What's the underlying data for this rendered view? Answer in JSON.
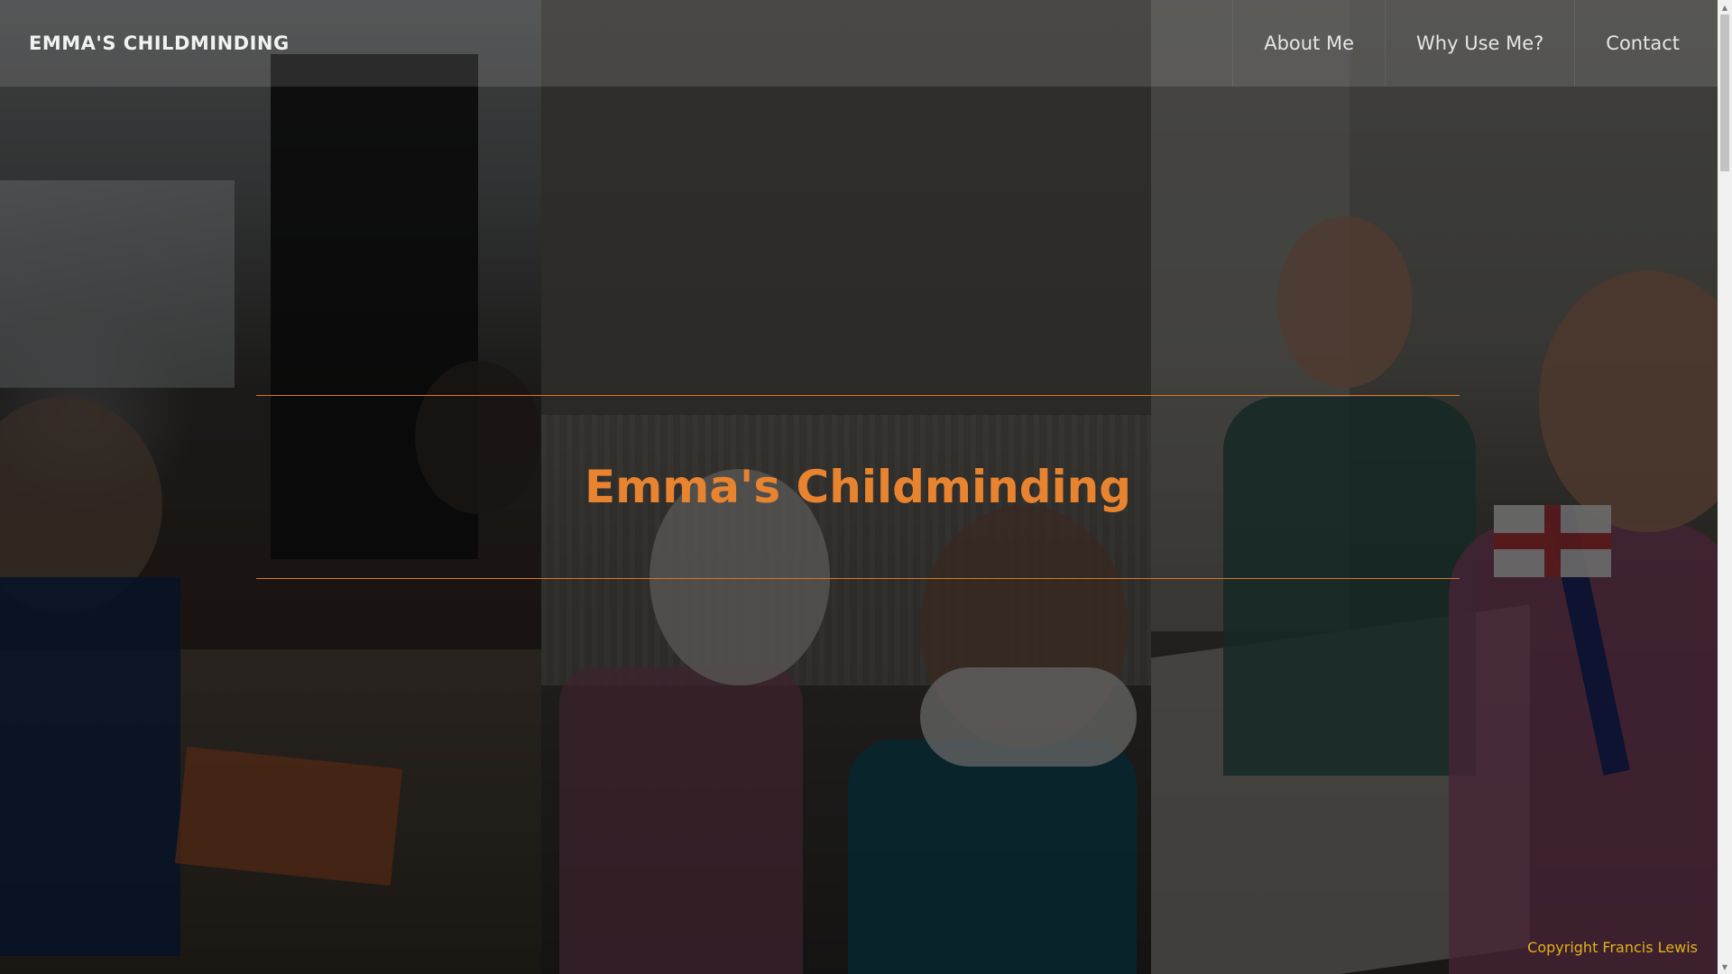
{
  "navbar": {
    "brand": "EMMA'S CHILDMINDING",
    "links": [
      {
        "label": "About Me"
      },
      {
        "label": "Why Use Me?"
      },
      {
        "label": "Contact"
      }
    ]
  },
  "hero": {
    "title": "Emma's Childminding"
  },
  "footer": {
    "copyright": "Copyright Francis Lewis"
  },
  "colors": {
    "accent": "#e8832f",
    "copyright": "#e0b21a"
  },
  "background": {
    "images": [
      "children-painting-photo",
      "bunny-masks-photo",
      "flag-craft-photo"
    ]
  }
}
